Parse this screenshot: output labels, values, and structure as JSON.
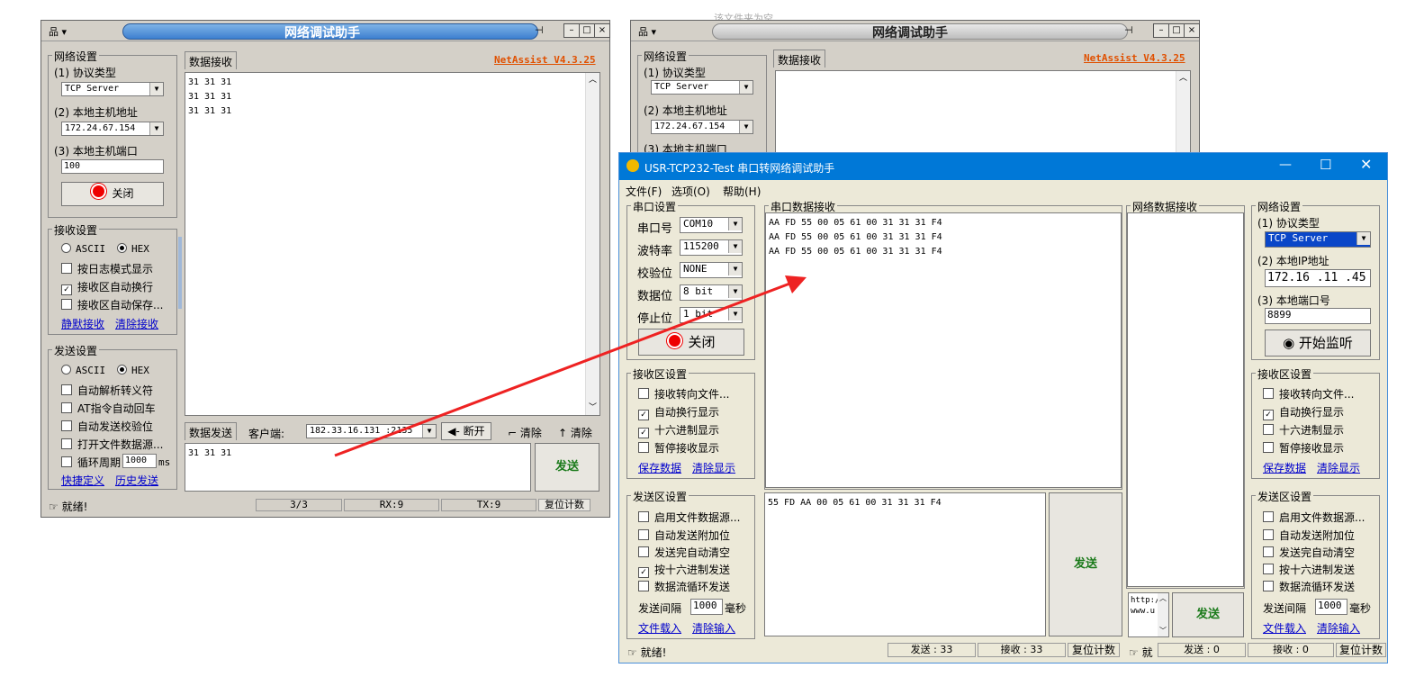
{
  "w1": {
    "title": "网络调试助手",
    "netassist": "NetAssist V4.3.25",
    "net_group": "网络设置",
    "proto_label": "(1) 协议类型",
    "proto_value": "TCP Server",
    "host_label": "(2) 本地主机地址",
    "host_value": "172.24.67.154",
    "port_label": "(3) 本地主机端口",
    "port_value": "100",
    "close_btn": "关闭",
    "recv_group": "接收设置",
    "ascii": "ASCII",
    "hex": "HEX",
    "recv_opts": [
      "按日志模式显示",
      "接收区自动换行",
      "接收区自动保存..."
    ],
    "recv_link1": "静默接收",
    "recv_link2": "清除接收",
    "send_group": "发送设置",
    "send_opts": [
      "自动解析转义符",
      "AT指令自动回车",
      "自动发送校验位",
      "打开文件数据源..."
    ],
    "cycle_label": "循环周期",
    "cycle_value": "1000",
    "cycle_unit": "ms",
    "send_link1": "快捷定义",
    "send_link2": "历史发送",
    "recv_tab": "数据接收",
    "recv_lines": [
      "31 31 31",
      "31 31 31",
      "31 31 31"
    ],
    "send_tab": "数据发送",
    "client_label": "客户端:",
    "client_value": "182.33.16.131 :2135",
    "disconnect": "断开",
    "clear1": "清除",
    "clear2": "清除",
    "send_text": "31 31 31",
    "send_btn": "发送",
    "status": "就绪!",
    "count": "3/3",
    "rx": "RX:9",
    "tx": "TX:9",
    "reset": "复位计数"
  },
  "w2": {
    "title": "网络调试助手",
    "netassist": "NetAssist V4.3.25",
    "net_group": "网络设置",
    "proto_label": "(1) 协议类型",
    "proto_value": "TCP Server",
    "host_label": "(2) 本地主机地址",
    "host_value": "172.24.67.154",
    "port_label": "(3) 本地主机端口",
    "recv_tab": "数据接收",
    "ghost_text": "该文件夹为空"
  },
  "usr": {
    "title": "USR-TCP232-Test 串口转网络调试助手",
    "menu": [
      "文件(F)",
      "选项(O)",
      "帮助(H)"
    ],
    "serial_group": "串口设置",
    "serial_fields": [
      {
        "label": "串口号",
        "value": "COM10"
      },
      {
        "label": "波特率",
        "value": "115200"
      },
      {
        "label": "校验位",
        "value": "NONE"
      },
      {
        "label": "数据位",
        "value": "8 bit"
      },
      {
        "label": "停止位",
        "value": "1 bit"
      }
    ],
    "close_btn": "关闭",
    "recv_group": "接收区设置",
    "recv_opts": [
      {
        "label": "接收转向文件...",
        "checked": false
      },
      {
        "label": "自动换行显示",
        "checked": true
      },
      {
        "label": "十六进制显示",
        "checked": true
      },
      {
        "label": "暂停接收显示",
        "checked": false
      }
    ],
    "recv_link1": "保存数据",
    "recv_link2": "清除显示",
    "send_group": "发送区设置",
    "send_opts": [
      {
        "label": "启用文件数据源...",
        "checked": false
      },
      {
        "label": "自动发送附加位",
        "checked": false
      },
      {
        "label": "发送完自动清空",
        "checked": false
      },
      {
        "label": "按十六进制发送",
        "checked": true
      },
      {
        "label": "数据流循环发送",
        "checked": false
      }
    ],
    "interval_label": "发送间隔",
    "interval_value": "1000",
    "interval_unit": "毫秒",
    "send_link1": "文件载入",
    "send_link2": "清除输入",
    "serial_recv_title": "串口数据接收",
    "serial_recv_lines": [
      "AA FD 55 00 05 61 00 31 31 31 F4",
      "AA FD 55 00 05 61 00 31 31 31 F4",
      "AA FD 55 00 05 61 00 31 31 31 F4"
    ],
    "serial_send_text": "55 FD AA 00 05 61 00 31 31 31 F4",
    "send_btn": "发送",
    "net_recv_title": "网络数据接收",
    "net_send_text": "http://www.u",
    "net_send_btn": "发送",
    "net_group": "网络设置",
    "net_proto_label": "(1) 协议类型",
    "net_proto_value": "TCP Server",
    "net_ip_label": "(2) 本地IP地址",
    "net_ip_value": "172.16 .11 .45",
    "net_port_label": "(3) 本地端口号",
    "net_port_value": "8899",
    "listen_btn": "开始监听",
    "net_recv_group": "接收区设置",
    "net_recv_opts": [
      {
        "label": "接收转向文件...",
        "checked": false
      },
      {
        "label": "自动换行显示",
        "checked": true
      },
      {
        "label": "十六进制显示",
        "checked": false
      },
      {
        "label": "暂停接收显示",
        "checked": false
      }
    ],
    "net_recv_link1": "保存数据",
    "net_recv_link2": "清除显示",
    "net_send_group": "发送区设置",
    "net_send_opts": [
      {
        "label": "启用文件数据源...",
        "checked": false
      },
      {
        "label": "自动发送附加位",
        "checked": false
      },
      {
        "label": "发送完自动清空",
        "checked": false
      },
      {
        "label": "按十六进制发送",
        "checked": false
      },
      {
        "label": "数据流循环发送",
        "checked": false
      }
    ],
    "net_interval_label": "发送间隔",
    "net_interval_value": "1000",
    "net_interval_unit": "毫秒",
    "net_send_link1": "文件载入",
    "net_send_link2": "清除输入",
    "status": "就绪!",
    "send_count": "发送 : 33",
    "recv_count": "接收 : 33",
    "reset": "复位计数",
    "status2": "就",
    "send_count2": "发送 : 0",
    "recv_count2": "接收 : 0",
    "reset2": "复位计数"
  },
  "colors": {
    "arrow": "#ee2222",
    "win10_title": "#0078d7",
    "link": "#0000cc",
    "send_green": "#1a7a1a"
  }
}
